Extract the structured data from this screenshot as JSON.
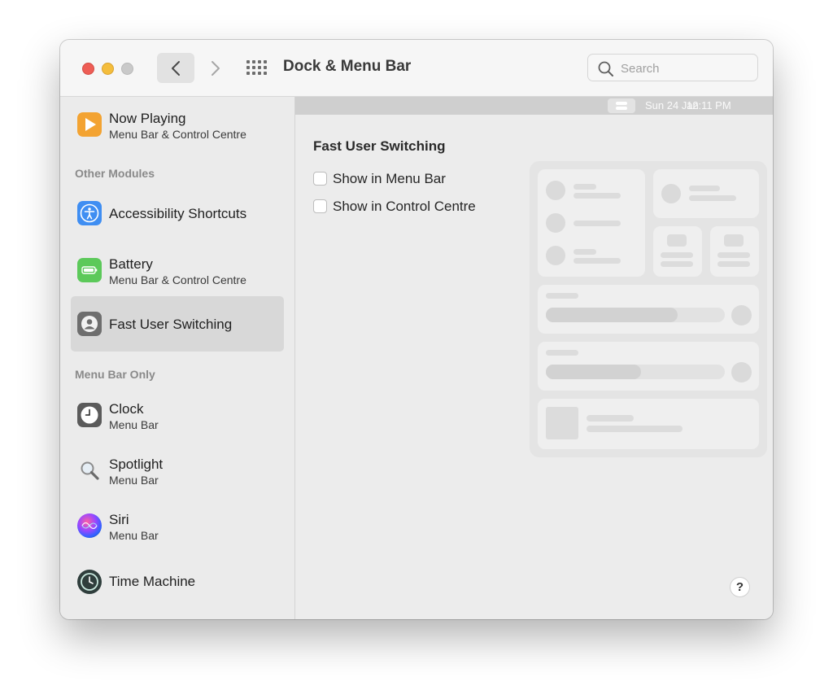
{
  "window": {
    "title": "Dock & Menu Bar",
    "search_placeholder": "Search"
  },
  "sidebar": {
    "items_top": [
      {
        "label": "Now Playing",
        "sub": "Menu Bar & Control Centre",
        "icon": "play-icon"
      }
    ],
    "section_other": "Other Modules",
    "items_other": [
      {
        "label": "Accessibility Shortcuts",
        "sub": "",
        "icon": "accessibility-icon"
      },
      {
        "label": "Battery",
        "sub": "Menu Bar & Control Centre",
        "icon": "battery-icon"
      },
      {
        "label": "Fast User Switching",
        "sub": "",
        "icon": "user-icon",
        "selected": true
      }
    ],
    "section_menubar": "Menu Bar Only",
    "items_menubar": [
      {
        "label": "Clock",
        "sub": "Menu Bar",
        "icon": "clock-icon"
      },
      {
        "label": "Spotlight",
        "sub": "Menu Bar",
        "icon": "magnifier-icon"
      },
      {
        "label": "Siri",
        "sub": "Menu Bar",
        "icon": "siri-icon"
      },
      {
        "label": "Time Machine",
        "sub": "",
        "icon": "time-machine-icon"
      }
    ]
  },
  "menubar_preview": {
    "date": "Sun 24 Jan",
    "time": "12:11 PM"
  },
  "content": {
    "heading": "Fast User Switching",
    "options": [
      {
        "label": "Show in Menu Bar",
        "checked": false
      },
      {
        "label": "Show in Control Centre",
        "checked": false
      }
    ],
    "help_label": "?"
  }
}
